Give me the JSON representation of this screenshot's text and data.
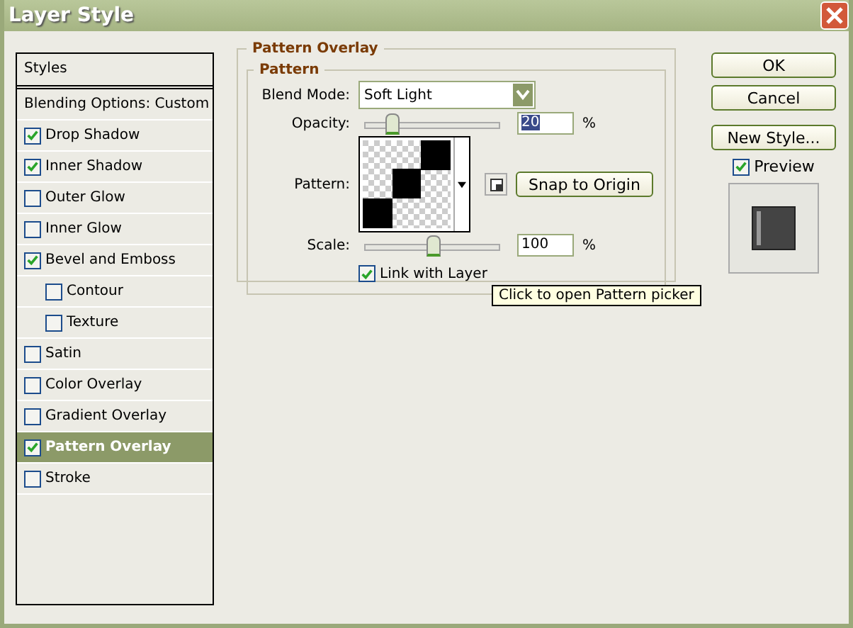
{
  "window": {
    "title": "Layer Style"
  },
  "sidebar": {
    "header": "Styles",
    "items": [
      {
        "label": "Blending Options: Custom",
        "kind": "plain",
        "selected": false
      },
      {
        "label": "Drop Shadow",
        "kind": "check",
        "checked": true,
        "selected": false
      },
      {
        "label": "Inner Shadow",
        "kind": "check",
        "checked": true,
        "selected": false
      },
      {
        "label": "Outer Glow",
        "kind": "check",
        "checked": false,
        "selected": false
      },
      {
        "label": "Inner Glow",
        "kind": "check",
        "checked": false,
        "selected": false
      },
      {
        "label": "Bevel and Emboss",
        "kind": "check",
        "checked": true,
        "selected": false,
        "children": [
          {
            "label": "Contour",
            "kind": "check",
            "checked": false,
            "selected": false
          },
          {
            "label": "Texture",
            "kind": "check",
            "checked": false,
            "selected": false
          }
        ]
      },
      {
        "label": "Satin",
        "kind": "check",
        "checked": false,
        "selected": false
      },
      {
        "label": "Color Overlay",
        "kind": "check",
        "checked": false,
        "selected": false
      },
      {
        "label": "Gradient Overlay",
        "kind": "check",
        "checked": false,
        "selected": false
      },
      {
        "label": "Pattern Overlay",
        "kind": "check",
        "checked": true,
        "selected": true
      },
      {
        "label": "Stroke",
        "kind": "check",
        "checked": false,
        "selected": false
      }
    ]
  },
  "panel": {
    "title": "Pattern Overlay",
    "group": "Pattern",
    "blend_mode": {
      "label": "Blend Mode:",
      "value": "Soft Light"
    },
    "opacity": {
      "label": "Opacity:",
      "level": 0.2,
      "value": "20",
      "unit": "%"
    },
    "pattern": {
      "label": "Pattern:",
      "button": "Snap to Origin"
    },
    "scale": {
      "label": "Scale:",
      "level": 0.5,
      "value": "100",
      "unit": "%"
    },
    "link": {
      "label": "Link with Layer",
      "checked": true
    },
    "tooltip": "Click to open Pattern picker"
  },
  "buttons": [
    "OK",
    "Cancel",
    "New Style..."
  ],
  "preview": {
    "label": "Preview",
    "checked": true
  }
}
